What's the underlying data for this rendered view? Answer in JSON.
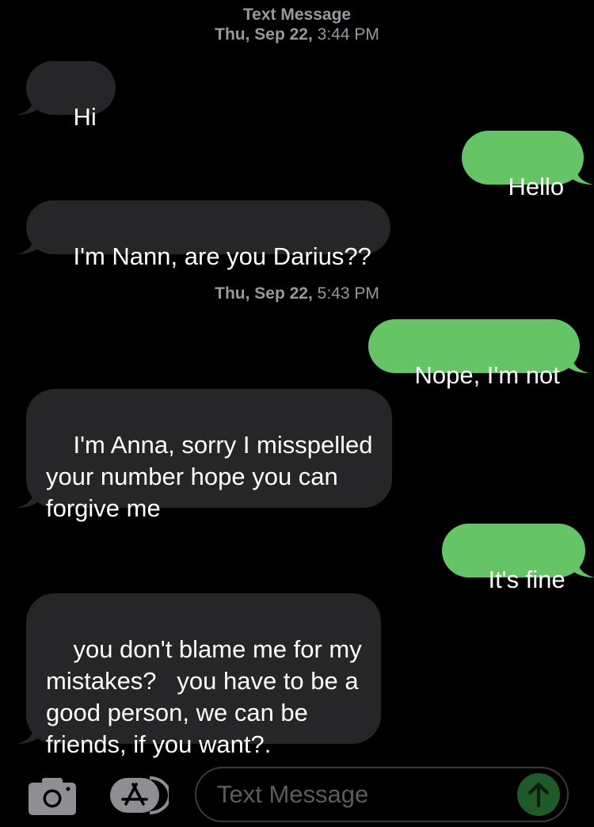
{
  "header": {
    "service": "Text Message",
    "first_timestamp_day": "Thu, Sep 22,",
    "first_timestamp_time": " 3:44 PM"
  },
  "separator": {
    "timestamp_day": "Thu, Sep 22,",
    "timestamp_time": " 5:43 PM"
  },
  "messages": [
    {
      "direction": "incoming",
      "text": "Hi"
    },
    {
      "direction": "outgoing",
      "text": "Hello"
    },
    {
      "direction": "incoming",
      "text": "I'm Nann, are you Darius??"
    },
    {
      "direction": "outgoing",
      "text": "Nope, I'm not"
    },
    {
      "direction": "incoming",
      "text": "I'm Anna, sorry I misspelled\nyour number hope you can\nforgive me"
    },
    {
      "direction": "outgoing",
      "text": "It's fine"
    },
    {
      "direction": "incoming",
      "text": "you don't blame me for my\nmistakes?   you have to be a\ngood person, we can be\nfriends, if you want?."
    }
  ],
  "composer": {
    "placeholder": "Text Message",
    "camera_icon": "camera-icon",
    "apps_icon": "app-store-icon",
    "send_icon": "send-arrow-icon"
  },
  "colors": {
    "background": "#000000",
    "incoming_bubble": "#262628",
    "outgoing_bubble": "#65c466",
    "meta_text": "#98989e",
    "placeholder": "#5c5c60",
    "send_button": "#1f5a28"
  }
}
